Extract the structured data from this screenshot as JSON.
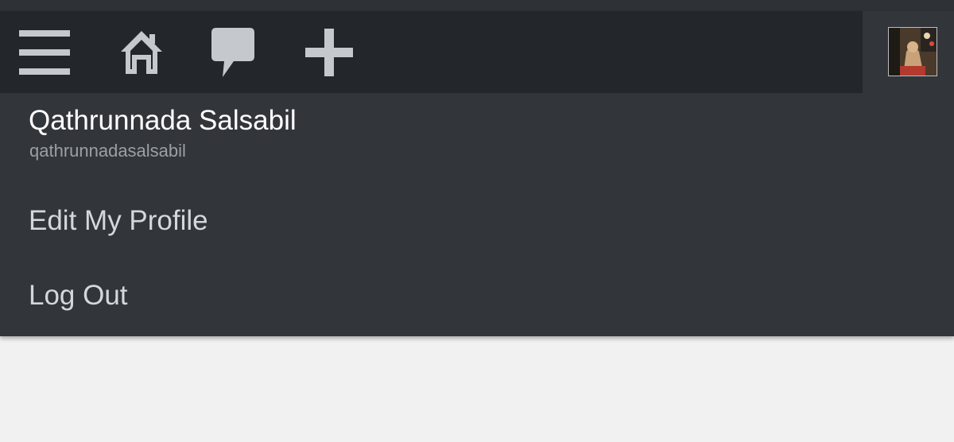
{
  "toolbar": {
    "icons": [
      "menu-icon",
      "home-icon",
      "comment-icon",
      "plus-icon"
    ],
    "icon_color": "#c5c9ce",
    "background": "#23272b"
  },
  "profile_menu": {
    "user_name": "Qathrunnada Salsabil",
    "user_handle": "qathrunnadasalsabil",
    "items": [
      {
        "label": "Edit My Profile"
      },
      {
        "label": "Log Out"
      }
    ],
    "background": "#32363b"
  }
}
